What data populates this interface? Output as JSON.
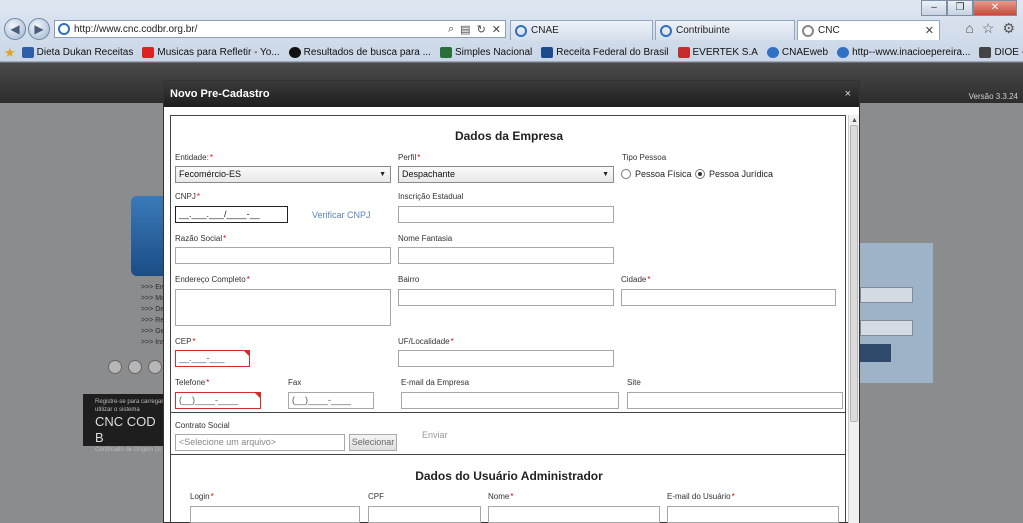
{
  "browser": {
    "url": "http://www.cnc.codbr.org.br/",
    "tabs": [
      {
        "label": "CNAE"
      },
      {
        "label": "Contribuinte"
      },
      {
        "label": "CNC"
      }
    ],
    "favorites": [
      "Dieta Dukan Receitas",
      "Musicas para Refletir - Yo...",
      "Resultados de busca para ...",
      "Simples Nacional",
      "Receita Federal do Brasil",
      "EVERTEK S.A",
      "CNAEweb",
      "http--www.inacioepereira...",
      "DIOE - Departamento de I..."
    ]
  },
  "page": {
    "version": "Versão 3.3.24",
    "bg_list": [
      ">>> Em",
      ">>> Mo",
      ">>> De",
      ">>> Re",
      ">>> Ge",
      ">>> Ins"
    ],
    "bg_cnc_small": "Registre-se para carregar utilizar o sistema",
    "bg_cnc_big": "CNC COD B",
    "bg_cnc_foot": "Certificado de Origem Di"
  },
  "modal": {
    "title": "Novo Pre-Cadastro",
    "close": "×",
    "empresa": {
      "title": "Dados da Empresa",
      "entidade_label": "Entidade:",
      "entidade_value": "Fecomércio-ES",
      "perfil_label": "Perfil",
      "perfil_value": "Despachante",
      "tipo_pessoa_label": "Tipo Pessoa",
      "pessoa_fisica": "Pessoa Física",
      "pessoa_juridica": "Pessoa Jurídica",
      "cnpj_label": "CNPJ",
      "cnpj_value": "__.___.___/____-__",
      "verificar_cnpj": "Verificar CNPJ",
      "inscricao_label": "Inscrição Estadual",
      "razao_label": "Razão Social",
      "fantasia_label": "Nome Fantasia",
      "endereco_label": "Endereço Completo",
      "bairro_label": "Bairro",
      "cidade_label": "Cidade",
      "cep_label": "CEP",
      "cep_value": "__.___-___",
      "uf_label": "UF/Localidade",
      "telefone_label": "Telefone",
      "telefone_value": "(__)____-____",
      "fax_label": "Fax",
      "fax_value": "(__)____-____",
      "email_label": "E-mail da Empresa",
      "site_label": "Site",
      "contrato_label": "Contrato Social",
      "contrato_placeholder": "<Selecione um arquivo>",
      "selecionar": "Selecionar",
      "enviar": "Enviar"
    },
    "usuario": {
      "title": "Dados do Usuário Administrador",
      "login_label": "Login",
      "cpf_label": "CPF",
      "nome_label": "Nome",
      "email_label": "E-mail do Usuário"
    }
  }
}
